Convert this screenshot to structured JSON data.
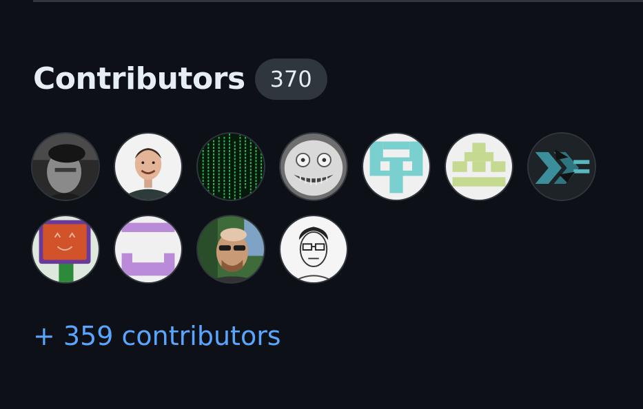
{
  "contributors": {
    "title": "Contributors",
    "count": "370",
    "more_link": "+ 359 contributors",
    "avatars": [
      {
        "icon": "person-photo-bw"
      },
      {
        "icon": "person-photo-smiling"
      },
      {
        "icon": "matrix-code-pattern"
      },
      {
        "icon": "grinning-mask-face"
      },
      {
        "icon": "teal-identicon"
      },
      {
        "icon": "green-identicon"
      },
      {
        "icon": "xmonad-logo"
      },
      {
        "icon": "orange-smiley-box"
      },
      {
        "icon": "purple-identicon"
      },
      {
        "icon": "person-photo-sunglasses"
      },
      {
        "icon": "person-sketch-glasses"
      }
    ]
  },
  "colors": {
    "background": "#0d1117",
    "text": "#e6edf3",
    "badge": "#30363d",
    "link": "#58a6ff"
  }
}
